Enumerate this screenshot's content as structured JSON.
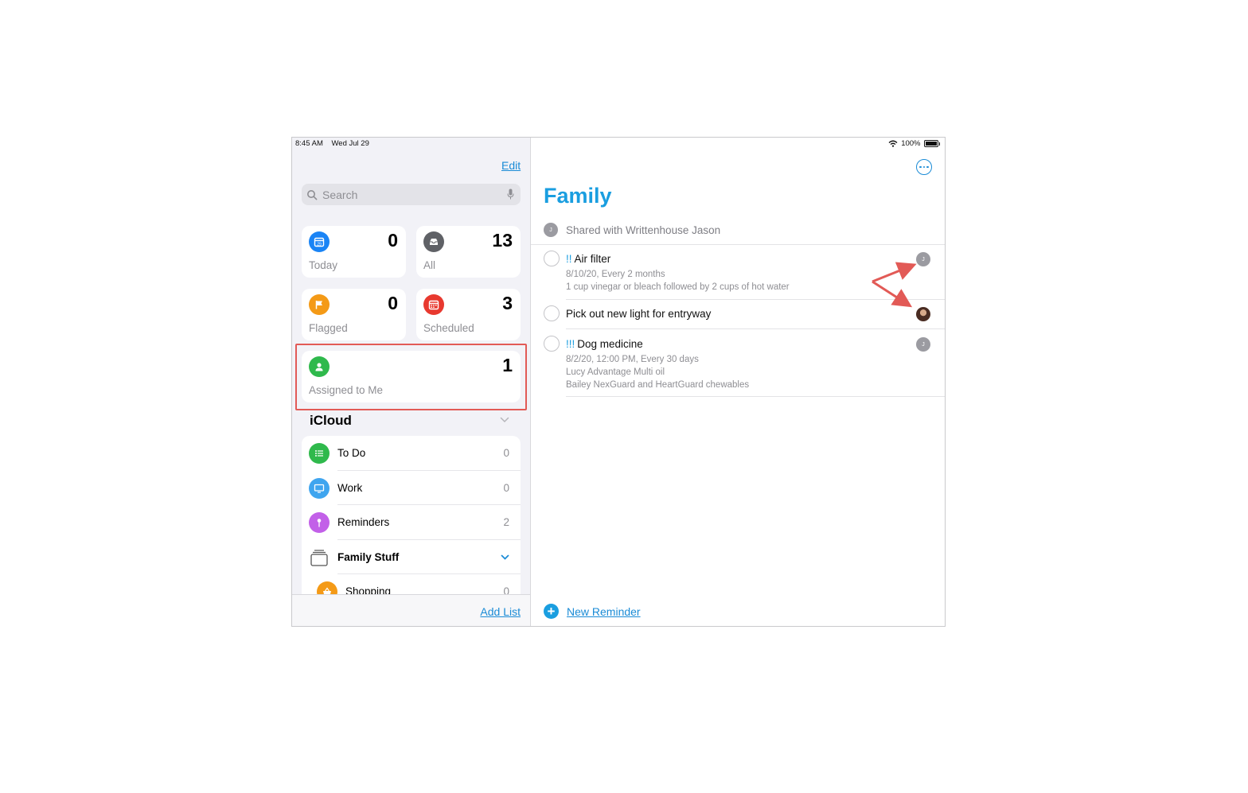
{
  "status_bar": {
    "time": "8:45 AM",
    "date": "Wed Jul 29",
    "battery": "100%"
  },
  "sidebar": {
    "edit_label": "Edit",
    "search_placeholder": "Search",
    "smart_lists": [
      {
        "label": "Today",
        "count": "0",
        "color": "#1a84f5",
        "icon": "calendar-today-icon"
      },
      {
        "label": "All",
        "count": "13",
        "color": "#5f6166",
        "icon": "tray-icon"
      },
      {
        "label": "Flagged",
        "count": "0",
        "color": "#f49a17",
        "icon": "flag-icon"
      },
      {
        "label": "Scheduled",
        "count": "3",
        "color": "#e8392f",
        "icon": "calendar-icon"
      },
      {
        "label": "Assigned to Me",
        "count": "1",
        "color": "#2fb94c",
        "icon": "person-icon"
      }
    ],
    "section_title": "iCloud",
    "lists": [
      {
        "name": "To Do",
        "count": "0",
        "color": "#2fb94c",
        "icon": "list-icon"
      },
      {
        "name": "Work",
        "count": "0",
        "color": "#3fa5ef",
        "icon": "monitor-icon"
      },
      {
        "name": "Reminders",
        "count": "2",
        "color": "#c260e8",
        "icon": "pin-icon"
      },
      {
        "name": "Family Stuff",
        "count": "",
        "color": "#333333",
        "icon": "group-stack-icon"
      },
      {
        "name": "Shopping",
        "count": "0",
        "color": "#f49a17",
        "icon": "basket-icon"
      }
    ],
    "add_list_label": "Add List"
  },
  "main": {
    "title": "Family",
    "shared_with": "Shared with Writtenhouse Jason",
    "avatar_initial": "J",
    "reminders": [
      {
        "priority": "!!",
        "title": "Air filter",
        "notes": [
          "8/10/20, Every 2 months",
          "1 cup vinegar or bleach followed by 2 cups of hot water"
        ],
        "assignee": "J"
      },
      {
        "priority": "",
        "title": "Pick out new light for entryway",
        "notes": [],
        "assignee": "photo"
      },
      {
        "priority": "!!!",
        "title": "Dog medicine",
        "notes": [
          "8/2/20, 12:00 PM, Every 30 days",
          "Lucy Advantage Multi oil",
          "Bailey NexGuard and HeartGuard chewables"
        ],
        "assignee": "J"
      }
    ],
    "new_reminder_label": "New Reminder"
  },
  "annotation_color": "#e25a56",
  "accent_color": "#1a9ee0"
}
